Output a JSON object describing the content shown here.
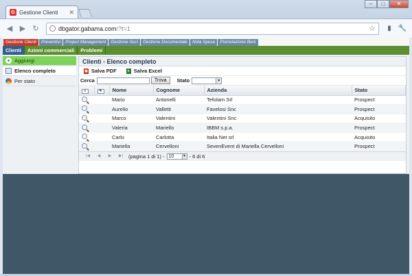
{
  "browser": {
    "tab_title": "Gestione Clienti",
    "tab_favicon": "G",
    "url_host": "dbgator.gabama.com",
    "url_path": "/?t=1",
    "window_controls": [
      "–",
      "□",
      "✕"
    ]
  },
  "topmenu": [
    "Gestione Clienti",
    "Preventivi",
    "Project Management",
    "Gestione Soci",
    "Gestione Documentale",
    "Nota Spese",
    "Prenotazione Beni"
  ],
  "submenu": [
    "Clienti",
    "Azioni commerciali",
    "Problemi"
  ],
  "sidebar": {
    "items": [
      {
        "label": "Aggiungi",
        "icon": "add-icon"
      },
      {
        "label": "Elenco completo",
        "icon": "list-icon"
      },
      {
        "label": "Per stato",
        "icon": "pie-chart-icon"
      }
    ]
  },
  "panel": {
    "title": "Clienti - Elenco completo",
    "save_pdf": "Salva PDF",
    "save_excel": "Salva Excel",
    "search_label": "Cerca",
    "search_value": "",
    "find_button": "Trova",
    "status_label": "Stato",
    "status_value": ""
  },
  "table": {
    "columns": [
      "Nome",
      "Cognome",
      "Azienda",
      "Stato"
    ],
    "rows": [
      [
        "Mario",
        "Antonelli",
        "Tefolam Srl",
        "Prospect"
      ],
      [
        "Aurelio",
        "Valletti",
        "Favelosi Snc",
        "Prospect"
      ],
      [
        "Marco",
        "Valentini",
        "Valentini Snc",
        "Acquisito"
      ],
      [
        "Valeria",
        "Mariello",
        "IBBM s.p.a.",
        "Prospect"
      ],
      [
        "Carlo",
        "Carlotta",
        "Italia Net srl",
        "Acquisito"
      ],
      [
        "Mariella",
        "Cervelloni",
        "SevenEvent di Mariella Cervelloni",
        "Prospect"
      ]
    ]
  },
  "pager": {
    "page_info": "(pagina 1 di 1) -",
    "page_size": "10",
    "count": "- 6 di 6"
  },
  "colors": {
    "active_module": "#c23a2b",
    "submenu_green": "#5a8e2e",
    "active_sub": "#2f5e8d",
    "add_green": "#7ed35a",
    "lower_bg": "#3f5867"
  }
}
